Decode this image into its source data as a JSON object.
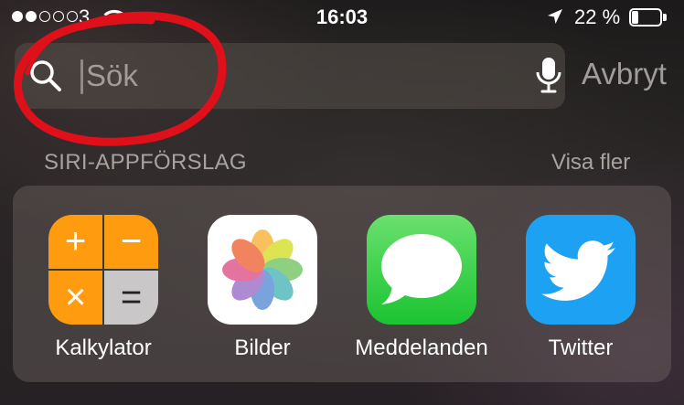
{
  "status_bar": {
    "carrier": "3",
    "time": "16:03",
    "battery_percent": "22 %",
    "battery_level": 0.22,
    "signal_strength": 2,
    "signal_max": 5
  },
  "search": {
    "placeholder": "Sök",
    "value": "",
    "cancel_label": "Avbryt"
  },
  "siri": {
    "section_title": "SIRI-APPFÖRSLAG",
    "show_more_label": "Visa fler",
    "apps": [
      {
        "label": "Kalkylator",
        "icon": "calculator-icon"
      },
      {
        "label": "Bilder",
        "icon": "photos-icon"
      },
      {
        "label": "Meddelanden",
        "icon": "messages-icon"
      },
      {
        "label": "Twitter",
        "icon": "twitter-icon"
      }
    ]
  },
  "calculator_symbols": {
    "plus": "+",
    "minus": "−",
    "times": "×",
    "equals": "="
  },
  "colors": {
    "annotation_red": "#e0101a",
    "calculator_orange": "#fe9b0f",
    "messages_green": "#1bc331",
    "twitter_blue": "#1da1f2"
  }
}
